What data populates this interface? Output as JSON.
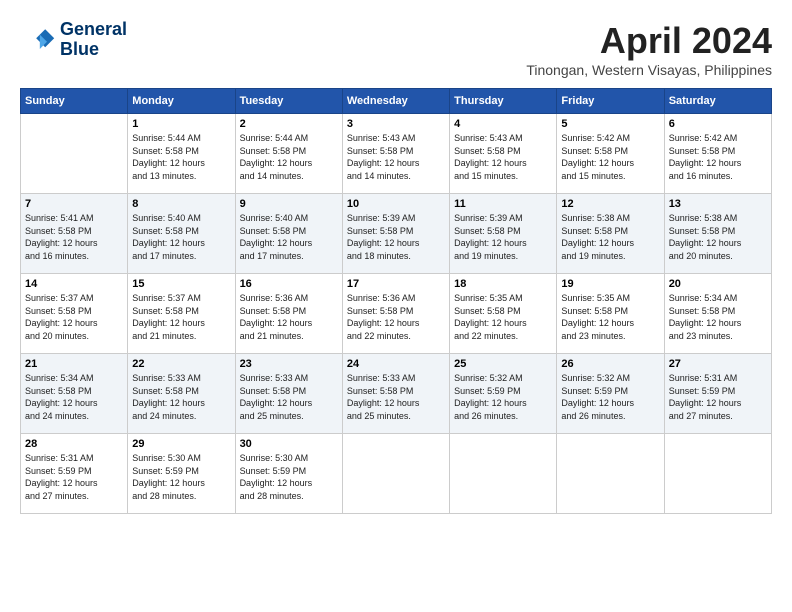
{
  "header": {
    "logo_line1": "General",
    "logo_line2": "Blue",
    "month": "April 2024",
    "location": "Tinongan, Western Visayas, Philippines"
  },
  "days_of_week": [
    "Sunday",
    "Monday",
    "Tuesday",
    "Wednesday",
    "Thursday",
    "Friday",
    "Saturday"
  ],
  "weeks": [
    [
      {
        "day": "",
        "text": ""
      },
      {
        "day": "1",
        "text": "Sunrise: 5:44 AM\nSunset: 5:58 PM\nDaylight: 12 hours\nand 13 minutes."
      },
      {
        "day": "2",
        "text": "Sunrise: 5:44 AM\nSunset: 5:58 PM\nDaylight: 12 hours\nand 14 minutes."
      },
      {
        "day": "3",
        "text": "Sunrise: 5:43 AM\nSunset: 5:58 PM\nDaylight: 12 hours\nand 14 minutes."
      },
      {
        "day": "4",
        "text": "Sunrise: 5:43 AM\nSunset: 5:58 PM\nDaylight: 12 hours\nand 15 minutes."
      },
      {
        "day": "5",
        "text": "Sunrise: 5:42 AM\nSunset: 5:58 PM\nDaylight: 12 hours\nand 15 minutes."
      },
      {
        "day": "6",
        "text": "Sunrise: 5:42 AM\nSunset: 5:58 PM\nDaylight: 12 hours\nand 16 minutes."
      }
    ],
    [
      {
        "day": "7",
        "text": "Sunrise: 5:41 AM\nSunset: 5:58 PM\nDaylight: 12 hours\nand 16 minutes."
      },
      {
        "day": "8",
        "text": "Sunrise: 5:40 AM\nSunset: 5:58 PM\nDaylight: 12 hours\nand 17 minutes."
      },
      {
        "day": "9",
        "text": "Sunrise: 5:40 AM\nSunset: 5:58 PM\nDaylight: 12 hours\nand 17 minutes."
      },
      {
        "day": "10",
        "text": "Sunrise: 5:39 AM\nSunset: 5:58 PM\nDaylight: 12 hours\nand 18 minutes."
      },
      {
        "day": "11",
        "text": "Sunrise: 5:39 AM\nSunset: 5:58 PM\nDaylight: 12 hours\nand 19 minutes."
      },
      {
        "day": "12",
        "text": "Sunrise: 5:38 AM\nSunset: 5:58 PM\nDaylight: 12 hours\nand 19 minutes."
      },
      {
        "day": "13",
        "text": "Sunrise: 5:38 AM\nSunset: 5:58 PM\nDaylight: 12 hours\nand 20 minutes."
      }
    ],
    [
      {
        "day": "14",
        "text": "Sunrise: 5:37 AM\nSunset: 5:58 PM\nDaylight: 12 hours\nand 20 minutes."
      },
      {
        "day": "15",
        "text": "Sunrise: 5:37 AM\nSunset: 5:58 PM\nDaylight: 12 hours\nand 21 minutes."
      },
      {
        "day": "16",
        "text": "Sunrise: 5:36 AM\nSunset: 5:58 PM\nDaylight: 12 hours\nand 21 minutes."
      },
      {
        "day": "17",
        "text": "Sunrise: 5:36 AM\nSunset: 5:58 PM\nDaylight: 12 hours\nand 22 minutes."
      },
      {
        "day": "18",
        "text": "Sunrise: 5:35 AM\nSunset: 5:58 PM\nDaylight: 12 hours\nand 22 minutes."
      },
      {
        "day": "19",
        "text": "Sunrise: 5:35 AM\nSunset: 5:58 PM\nDaylight: 12 hours\nand 23 minutes."
      },
      {
        "day": "20",
        "text": "Sunrise: 5:34 AM\nSunset: 5:58 PM\nDaylight: 12 hours\nand 23 minutes."
      }
    ],
    [
      {
        "day": "21",
        "text": "Sunrise: 5:34 AM\nSunset: 5:58 PM\nDaylight: 12 hours\nand 24 minutes."
      },
      {
        "day": "22",
        "text": "Sunrise: 5:33 AM\nSunset: 5:58 PM\nDaylight: 12 hours\nand 24 minutes."
      },
      {
        "day": "23",
        "text": "Sunrise: 5:33 AM\nSunset: 5:58 PM\nDaylight: 12 hours\nand 25 minutes."
      },
      {
        "day": "24",
        "text": "Sunrise: 5:33 AM\nSunset: 5:58 PM\nDaylight: 12 hours\nand 25 minutes."
      },
      {
        "day": "25",
        "text": "Sunrise: 5:32 AM\nSunset: 5:59 PM\nDaylight: 12 hours\nand 26 minutes."
      },
      {
        "day": "26",
        "text": "Sunrise: 5:32 AM\nSunset: 5:59 PM\nDaylight: 12 hours\nand 26 minutes."
      },
      {
        "day": "27",
        "text": "Sunrise: 5:31 AM\nSunset: 5:59 PM\nDaylight: 12 hours\nand 27 minutes."
      }
    ],
    [
      {
        "day": "28",
        "text": "Sunrise: 5:31 AM\nSunset: 5:59 PM\nDaylight: 12 hours\nand 27 minutes."
      },
      {
        "day": "29",
        "text": "Sunrise: 5:30 AM\nSunset: 5:59 PM\nDaylight: 12 hours\nand 28 minutes."
      },
      {
        "day": "30",
        "text": "Sunrise: 5:30 AM\nSunset: 5:59 PM\nDaylight: 12 hours\nand 28 minutes."
      },
      {
        "day": "",
        "text": ""
      },
      {
        "day": "",
        "text": ""
      },
      {
        "day": "",
        "text": ""
      },
      {
        "day": "",
        "text": ""
      }
    ]
  ]
}
